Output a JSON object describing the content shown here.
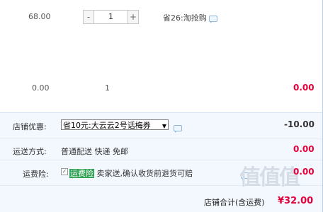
{
  "item1": {
    "price": "68.00",
    "quantity": "1",
    "minus": "-",
    "plus": "+",
    "saving": "省26:淘抢购"
  },
  "item2": {
    "price": "0.00",
    "quantity": "1",
    "subtotal": "0.00"
  },
  "shop_discount": {
    "label": "店铺优惠:",
    "selected": "省10元:大云云2号话梅券",
    "amount": "-10.00"
  },
  "shipping": {
    "label": "运送方式:",
    "text": "普通配送 快递 免邮",
    "amount": "0.00"
  },
  "insurance": {
    "label": "运费险:",
    "tag": "运费险",
    "text": "卖家送,确认收货前退货可赔",
    "amount": "0.00"
  },
  "total": {
    "label": "店铺合计(含运费)",
    "amount": "¥32.00"
  },
  "watermark": "值值值"
}
